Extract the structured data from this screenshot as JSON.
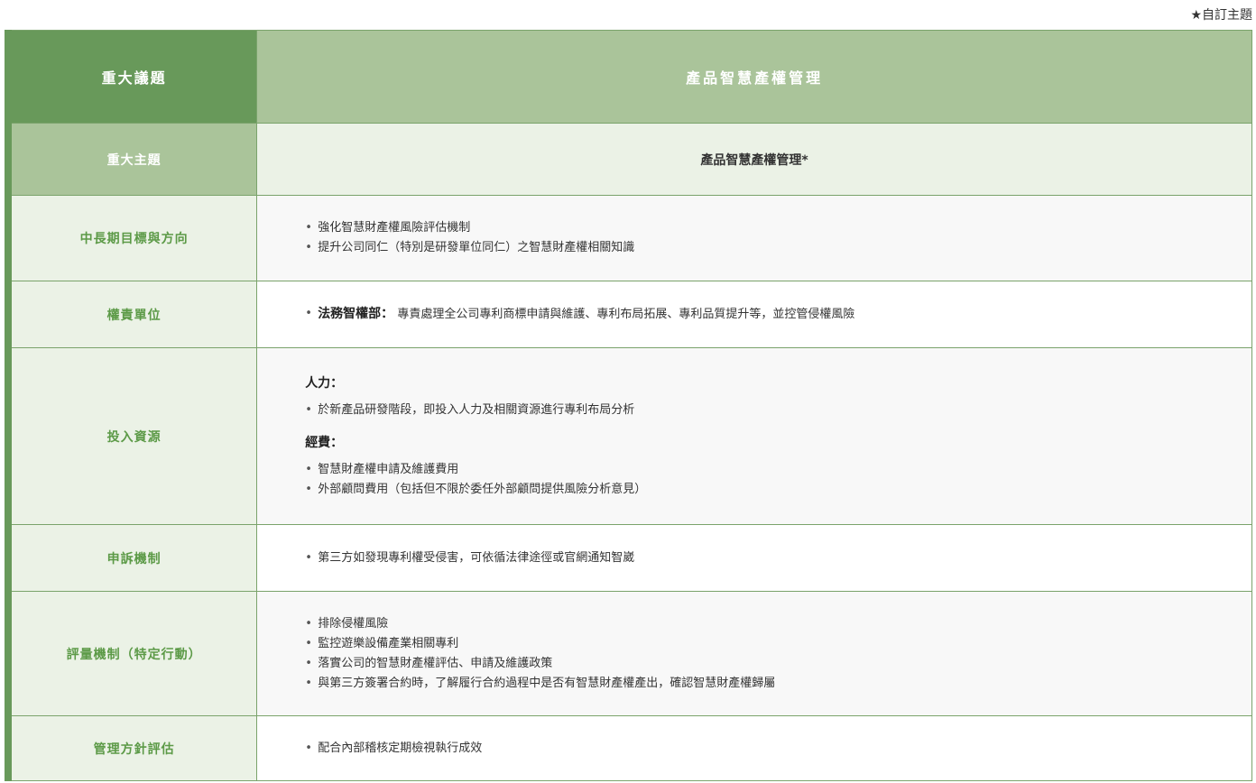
{
  "note": "★自訂主題",
  "header": {
    "left": "重大議題",
    "right": "產品智慧產權管理"
  },
  "subheader": {
    "left": "重大主題",
    "right": "產品智慧產權管理*"
  },
  "rows": {
    "goals": {
      "label": "中長期目標與方向",
      "items": [
        "強化智慧財產權風險評估機制",
        "提升公司同仁（特別是研發單位同仁）之智慧財產權相關知識"
      ]
    },
    "responsible": {
      "label": "權責單位",
      "dept": "法務智權部：",
      "desc": "專責處理全公司專利商標申請與維護、專利布局拓展、專利品質提升等，並控管侵權風險"
    },
    "resources": {
      "label": "投入資源",
      "manpower_title": "人力：",
      "manpower_items": [
        "於新產品研發階段，即投入人力及相關資源進行專利布局分析"
      ],
      "budget_title": "經費：",
      "budget_items": [
        "智慧財產權申請及維護費用",
        "外部顧問費用（包括但不限於委任外部顧問提供風險分析意見）"
      ]
    },
    "grievance": {
      "label": "申訴機制",
      "items": [
        "第三方如發現專利權受侵害，可依循法律途徑或官網通知智崴"
      ]
    },
    "evaluation": {
      "label": "評量機制（特定行動）",
      "items": [
        "排除侵權風險",
        "監控遊樂設備產業相關專利",
        "落實公司的智慧財產權評估、申請及維護政策",
        "與第三方簽署合約時，了解履行合約過程中是否有智慧財產權產出，確認智慧財產權歸屬"
      ]
    },
    "assessment": {
      "label": "管理方針評估",
      "items": [
        "配合內部稽核定期檢視執行成效"
      ]
    }
  }
}
